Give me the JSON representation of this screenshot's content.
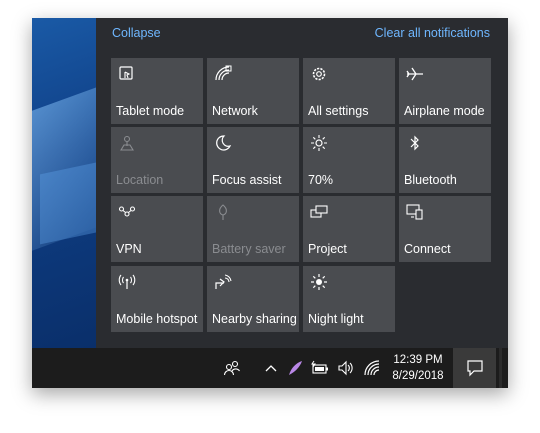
{
  "header": {
    "collapse_label": "Collapse",
    "clear_all_label": "Clear all notifications"
  },
  "tiles": [
    {
      "label": "Tablet mode",
      "icon": "tablet-mode-icon",
      "enabled": true
    },
    {
      "label": "Network",
      "icon": "network-icon",
      "enabled": true
    },
    {
      "label": "All settings",
      "icon": "gear-icon",
      "enabled": true
    },
    {
      "label": "Airplane mode",
      "icon": "airplane-icon",
      "enabled": true
    },
    {
      "label": "Location",
      "icon": "location-icon",
      "enabled": false
    },
    {
      "label": "Focus assist",
      "icon": "moon-icon",
      "enabled": true
    },
    {
      "label": "70%",
      "icon": "brightness-icon",
      "enabled": true
    },
    {
      "label": "Bluetooth",
      "icon": "bluetooth-icon",
      "enabled": true
    },
    {
      "label": "VPN",
      "icon": "vpn-icon",
      "enabled": true
    },
    {
      "label": "Battery saver",
      "icon": "battery-saver-icon",
      "enabled": false
    },
    {
      "label": "Project",
      "icon": "project-icon",
      "enabled": true
    },
    {
      "label": "Connect",
      "icon": "connect-icon",
      "enabled": true
    },
    {
      "label": "Mobile hotspot",
      "icon": "hotspot-icon",
      "enabled": true
    },
    {
      "label": "Nearby sharing",
      "icon": "nearby-sharing-icon",
      "enabled": true
    },
    {
      "label": "Night light",
      "icon": "night-light-icon",
      "enabled": true
    }
  ],
  "taskbar": {
    "time": "12:39 PM",
    "date": "8/29/2018"
  },
  "colors": {
    "accent": "#6fb7ff",
    "tile": "#4a4c50",
    "panel": "#2a2c30",
    "taskbar": "#1c1c1c"
  }
}
